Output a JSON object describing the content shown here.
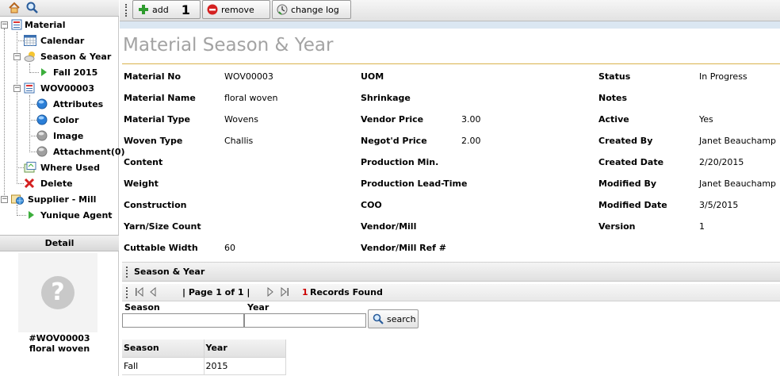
{
  "tree": {
    "items": [
      {
        "label": "Material"
      },
      {
        "label": "Calendar"
      },
      {
        "label": "Season & Year"
      },
      {
        "label": "Fall 2015"
      },
      {
        "label": "WOV00003"
      },
      {
        "label": "Attributes"
      },
      {
        "label": "Color"
      },
      {
        "label": "Image"
      },
      {
        "label": "Attachment(0)"
      },
      {
        "label": "Where Used"
      },
      {
        "label": "Delete"
      },
      {
        "label": "Supplier - Mill"
      },
      {
        "label": "Yunique Agent"
      }
    ]
  },
  "detail": {
    "header": "Detail",
    "placeholder_glyph": "?",
    "caption_line1": "#WOV00003",
    "caption_line2": "floral woven"
  },
  "toolbar": {
    "add_label": "add",
    "add_count": "1",
    "remove_label": "remove",
    "changelog_label": "change log"
  },
  "page_title": "Material Season & Year",
  "fields": {
    "col1": [
      {
        "label": "Material No",
        "value": "WOV00003"
      },
      {
        "label": "Material Name",
        "value": "floral woven"
      },
      {
        "label": "Material Type",
        "value": "Wovens"
      },
      {
        "label": "Woven Type",
        "value": "Challis"
      },
      {
        "label": "Content",
        "value": ""
      },
      {
        "label": "Weight",
        "value": ""
      },
      {
        "label": "Construction",
        "value": ""
      },
      {
        "label": "Yarn/Size Count",
        "value": ""
      },
      {
        "label": "Cuttable Width",
        "value": "60"
      }
    ],
    "col2": [
      {
        "label": "UOM",
        "value": ""
      },
      {
        "label": "Shrinkage",
        "value": ""
      },
      {
        "label": "Vendor Price",
        "value": "3.00"
      },
      {
        "label": "Negot'd Price",
        "value": "2.00"
      },
      {
        "label": "Production Min.",
        "value": ""
      },
      {
        "label": "Production Lead-Time",
        "value": ""
      },
      {
        "label": "COO",
        "value": ""
      },
      {
        "label": "Vendor/Mill",
        "value": ""
      },
      {
        "label": "Vendor/Mill Ref #",
        "value": ""
      }
    ],
    "col3": [
      {
        "label": "Status",
        "value": "In Progress"
      },
      {
        "label": "Notes",
        "value": ""
      },
      {
        "label": "Active",
        "value": "Yes"
      },
      {
        "label": "Created By",
        "value": "Janet Beauchamp"
      },
      {
        "label": "Created Date",
        "value": "2/20/2015"
      },
      {
        "label": "Modified By",
        "value": "Janet Beauchamp"
      },
      {
        "label": "Modified Date",
        "value": "3/5/2015"
      },
      {
        "label": "Version",
        "value": "1"
      }
    ]
  },
  "season_section": {
    "title": "Season & Year",
    "pager_text": "| Page 1 of 1 |",
    "records_count": "1",
    "records_label": "Records Found",
    "filter_season_label": "Season",
    "filter_year_label": "Year",
    "search_label": "search",
    "grid": {
      "columns": [
        "Season",
        "Year"
      ],
      "rows": [
        [
          "Fall",
          "2015"
        ]
      ]
    }
  },
  "colors": {
    "title_gray": "#a3a3a3",
    "rule_gold": "#d9b24c",
    "records_red": "#cc0000",
    "add_green": "#2e9b2e",
    "remove_red": "#d42020",
    "node_blue": "#2b7fd8"
  }
}
